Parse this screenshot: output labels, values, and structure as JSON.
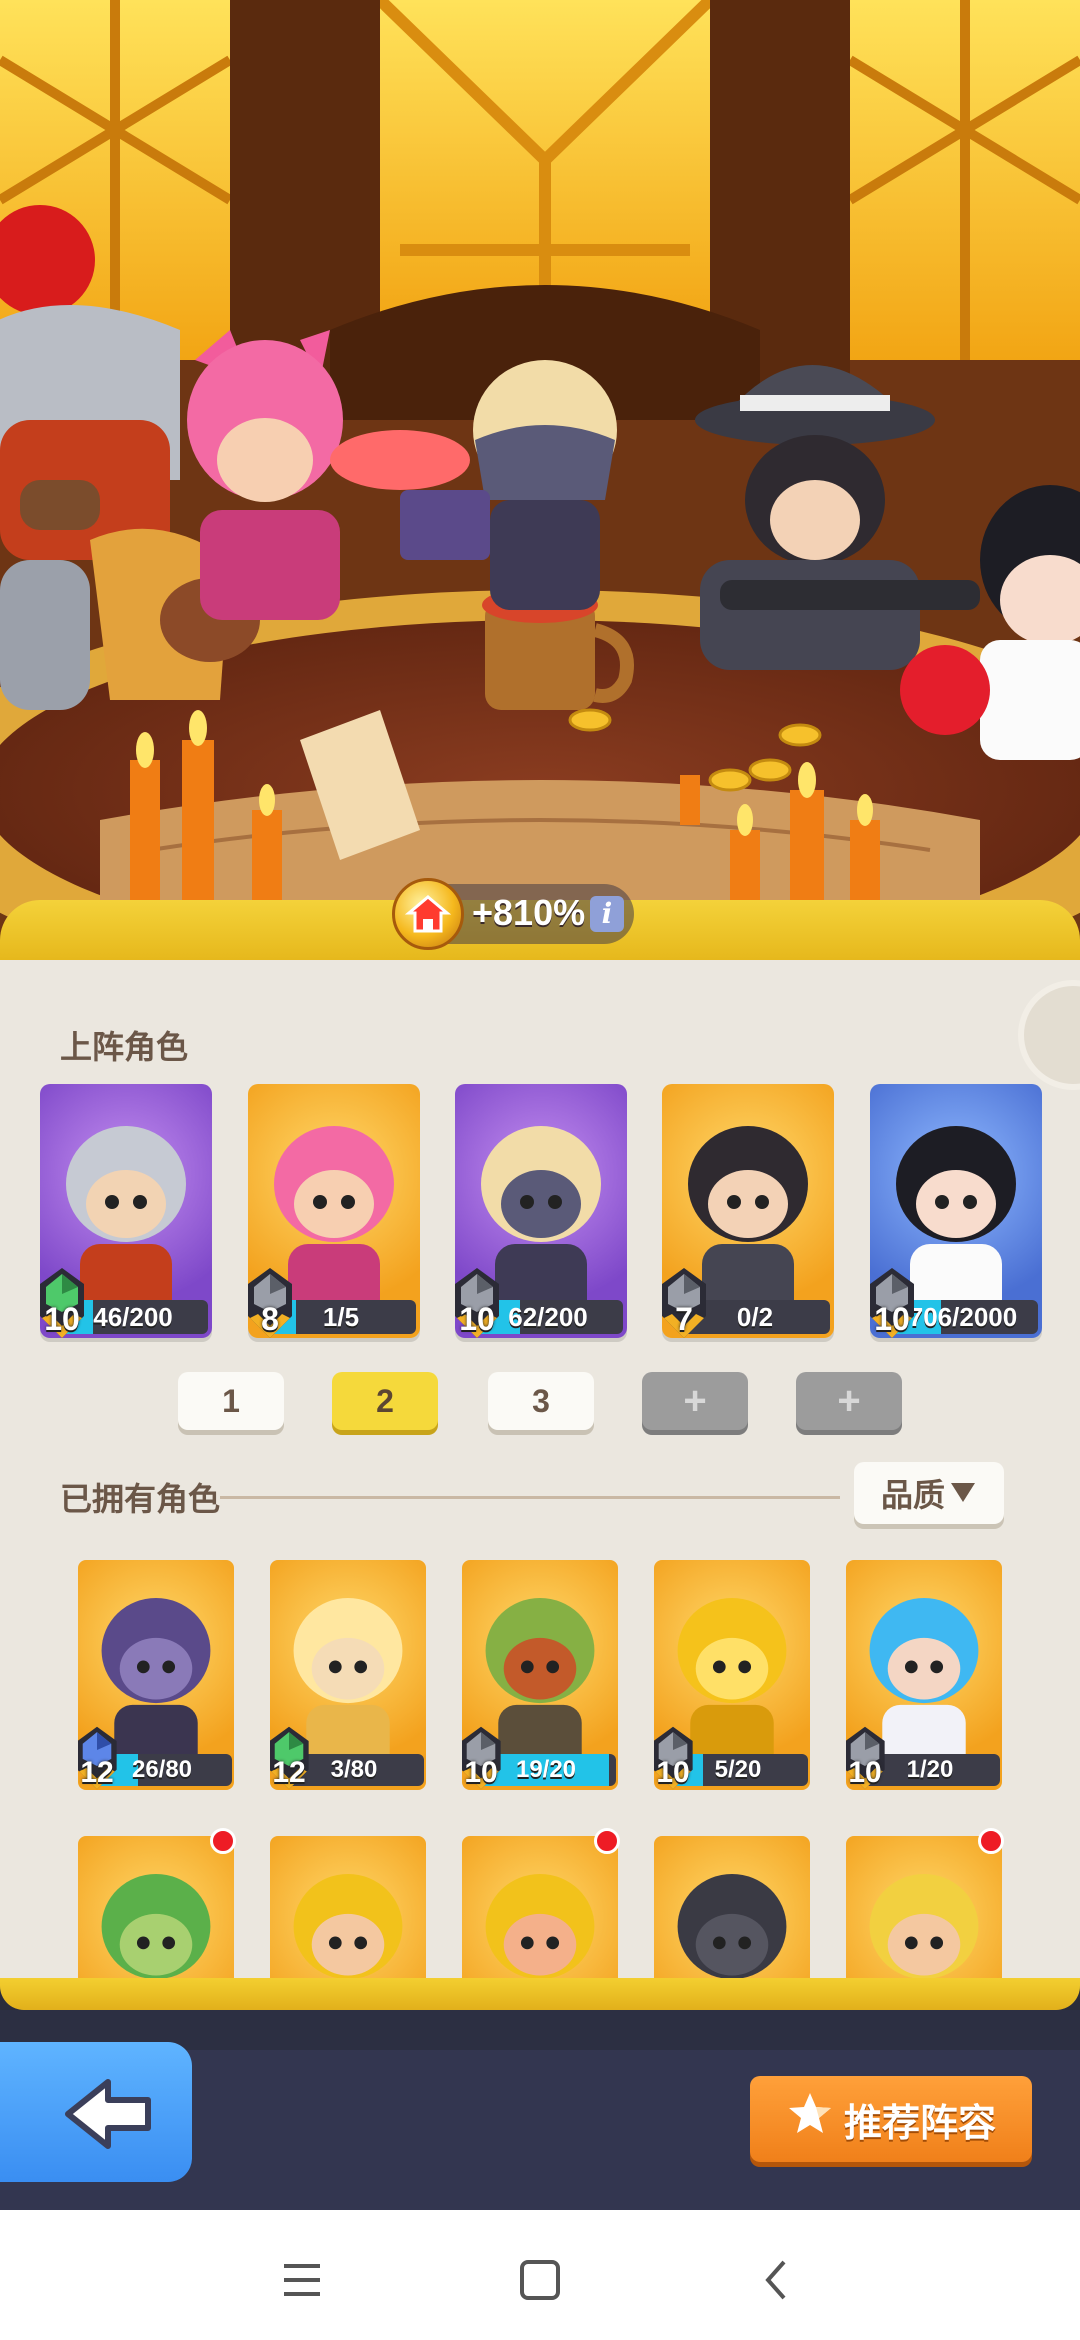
{
  "bonus": {
    "icon": "home-coin-icon",
    "value": "+810%",
    "info_icon": "i"
  },
  "lineup": {
    "title": "上阵角色",
    "heroes": [
      {
        "name_icon": "knight-hero-icon",
        "level": "10",
        "progress": "46/200",
        "fill": 0.23,
        "bg": "purple",
        "gem": "green"
      },
      {
        "name_icon": "pink-cat-hero-icon",
        "level": "8",
        "progress": "1/5",
        "fill": 0.2,
        "bg": "orange",
        "gem": "gray"
      },
      {
        "name_icon": "masked-knight-hero-icon",
        "level": "10",
        "progress": "62/200",
        "fill": 0.31,
        "bg": "purple",
        "gem": "gray"
      },
      {
        "name_icon": "gangster-guitar-hero-icon",
        "level": "7",
        "progress": "0/2",
        "fill": 0.0,
        "bg": "orange",
        "gem": "gray"
      },
      {
        "name_icon": "cheerleader-hero-icon",
        "level": "10",
        "progress": "706/2000",
        "fill": 0.35,
        "bg": "blue",
        "gem": "gray"
      }
    ]
  },
  "teams": {
    "tabs": [
      "1",
      "2",
      "3",
      "+",
      "+"
    ],
    "active_index": 1
  },
  "owned": {
    "title": "已拥有角色",
    "sort_label": "品质",
    "sort_icon": "triangle-down-icon",
    "heroes": [
      {
        "name_icon": "dark-elf-hero-icon",
        "level": "12",
        "progress": "26/80",
        "fill": 0.33,
        "gem": "blue"
      },
      {
        "name_icon": "angel-hero-icon",
        "level": "12",
        "progress": "3/80",
        "fill": 0.04,
        "gem": "green"
      },
      {
        "name_icon": "goblin-tnt-hero-icon",
        "level": "10",
        "progress": "19/20",
        "fill": 0.95,
        "gem": "gray"
      },
      {
        "name_icon": "golden-knight-hero-icon",
        "level": "10",
        "progress": "5/20",
        "fill": 0.25,
        "gem": "gray"
      },
      {
        "name_icon": "ice-queen-hero-icon",
        "level": "10",
        "progress": "1/20",
        "fill": 0.05,
        "gem": "gray"
      }
    ],
    "row2": [
      {
        "name_icon": "green-king-hero-icon",
        "red_dot": true
      },
      {
        "name_icon": "crowned-bearded-hero-icon",
        "red_dot": false
      },
      {
        "name_icon": "red-hair-king-hero-icon",
        "red_dot": true
      },
      {
        "name_icon": "dark-hooded-hero-icon",
        "red_dot": false
      },
      {
        "name_icon": "blonde-headband-hero-icon",
        "red_dot": true
      }
    ]
  },
  "footer": {
    "back_icon": "back-arrow-icon",
    "recommend_label": "推荐阵容",
    "recommend_icon": "star-icon"
  },
  "system_nav": {
    "menu_icon": "menu-icon",
    "home_icon": "home-square-icon",
    "back_icon": "back-chevron-icon"
  }
}
